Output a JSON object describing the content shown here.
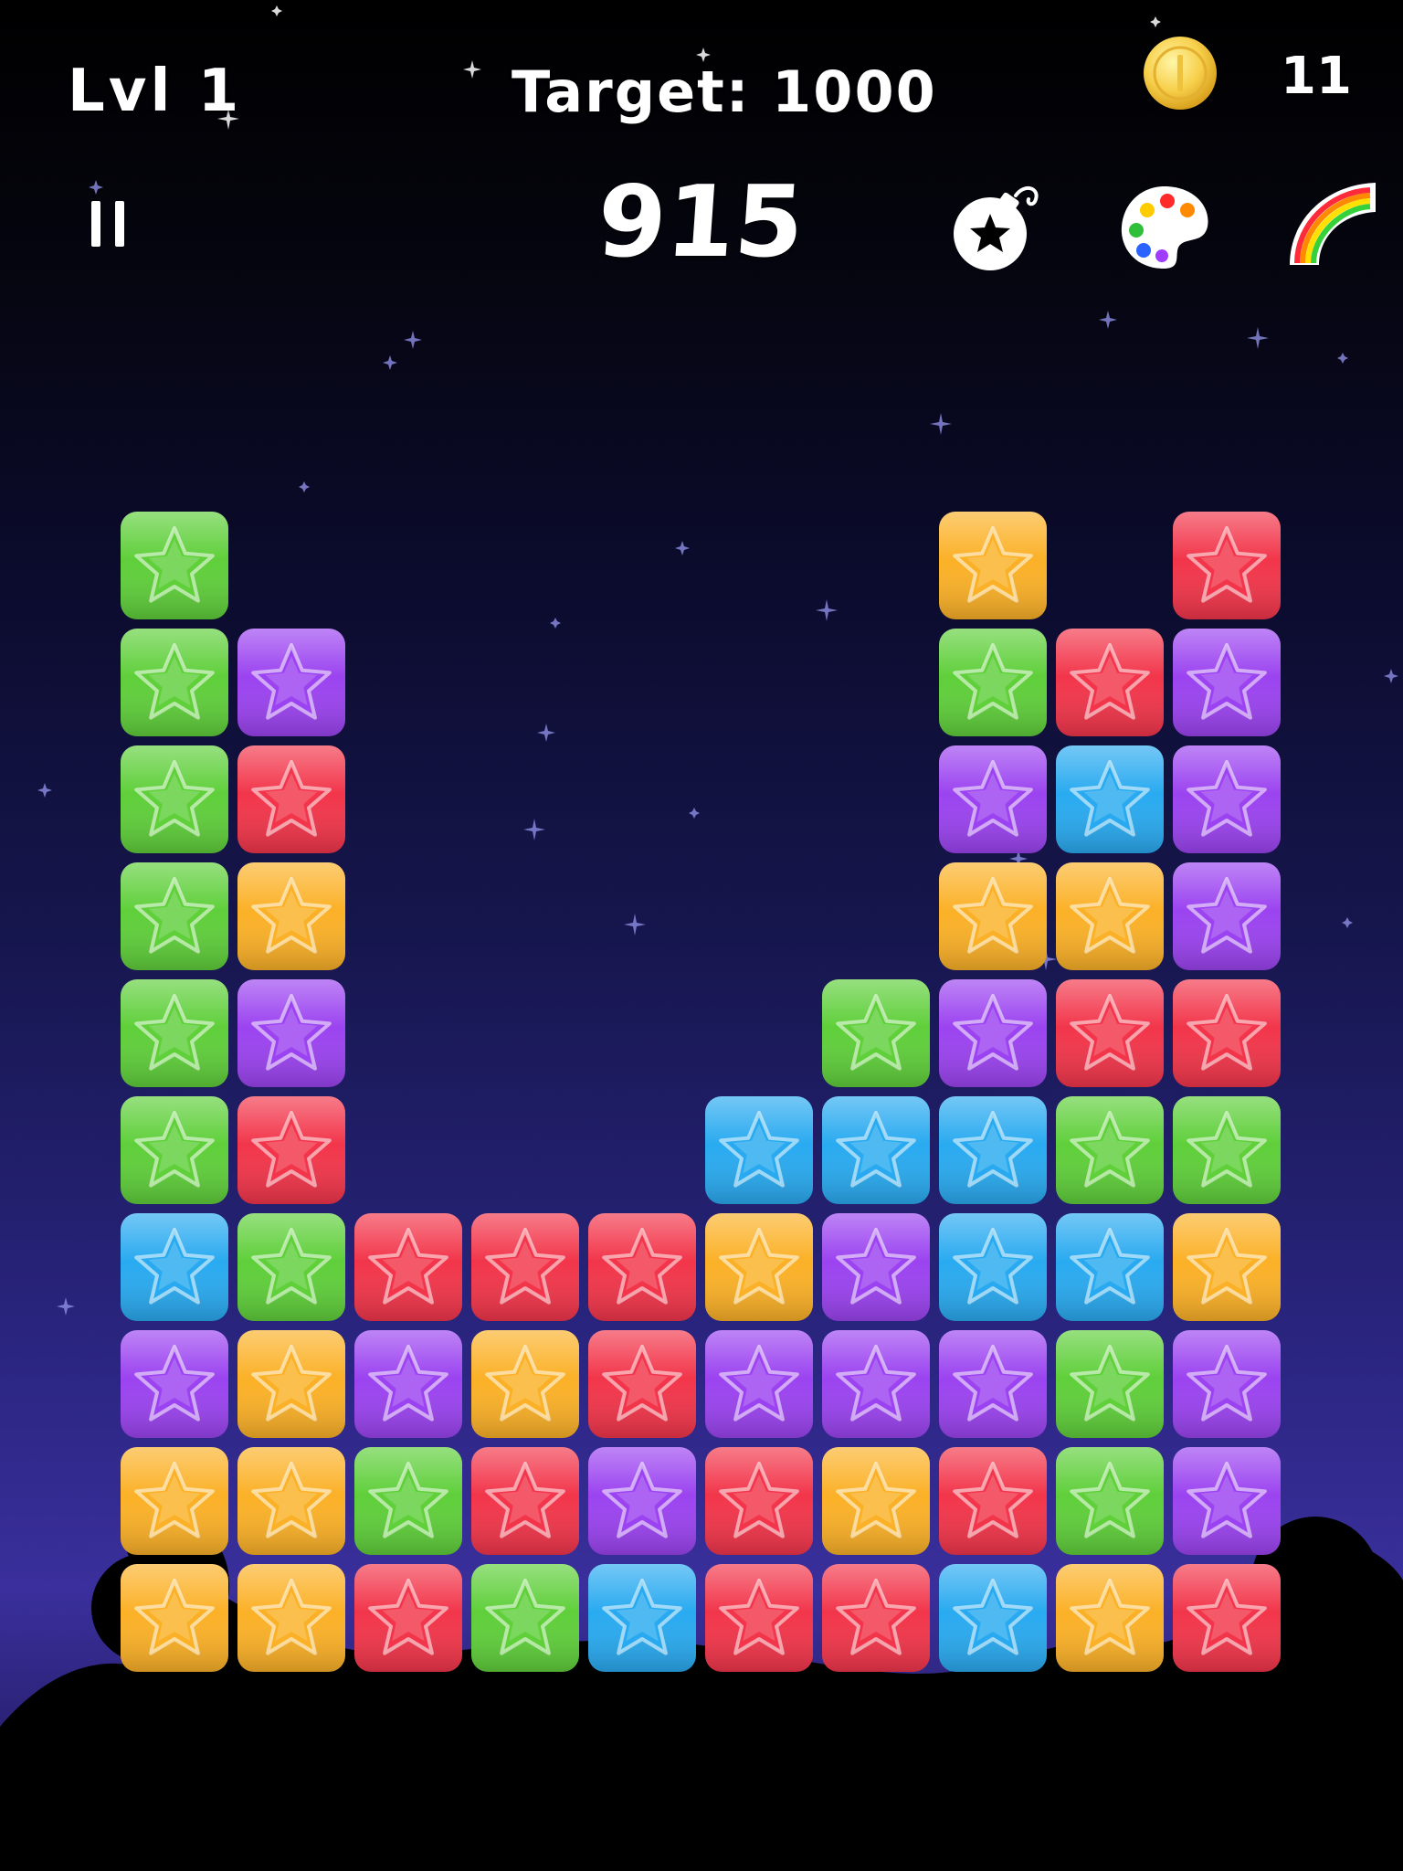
{
  "hud": {
    "level": "Lvl 1",
    "target": "Target: 1000",
    "score": "915",
    "coins": "11"
  },
  "tools": [
    "bomb",
    "palette",
    "rainbow"
  ],
  "colors": {
    "G": "#5fcf3a",
    "P": "#9b43f0",
    "R": "#f2354a",
    "O": "#fbb127",
    "B": "#29aaf0"
  },
  "board": {
    "rows": [
      "G......O.R.",
      "GP.....GRP.",
      "GR.....PBP.",
      "GO.....OOP.",
      "GP....GPRR.",
      "GR...BBBGG.",
      "BGRRROPBBO.",
      "POPORPPPGP.",
      "OOGRPROR GP",
      "OORGBRRBOR."
    ]
  }
}
